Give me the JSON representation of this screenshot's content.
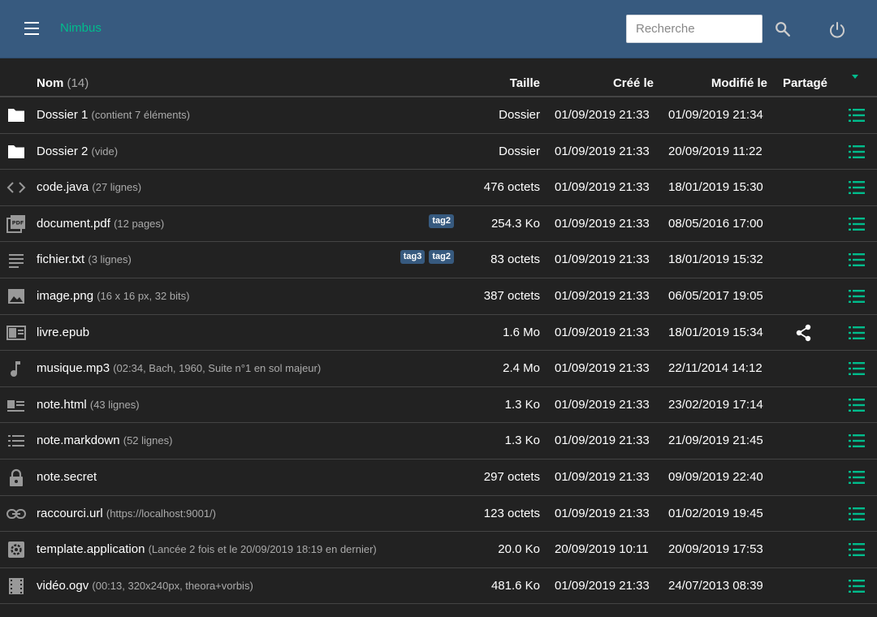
{
  "header": {
    "brand": "Nimbus",
    "search_placeholder": "Recherche",
    "accent_color": "#00bc8c",
    "bar_color": "#375a7f"
  },
  "table": {
    "columns": {
      "name": "Nom",
      "count": "(14)",
      "size": "Taille",
      "created": "Créé le",
      "modified": "Modifié le",
      "shared": "Partagé"
    },
    "rows": [
      {
        "icon": "folder-icon",
        "name": "Dossier 1",
        "detail": "(contient 7 éléments)",
        "tags": [],
        "size": "Dossier",
        "created": "01/09/2019 21:33",
        "modified": "01/09/2019 21:34",
        "shared": false
      },
      {
        "icon": "folder-icon",
        "name": "Dossier 2",
        "detail": "(vide)",
        "tags": [],
        "size": "Dossier",
        "created": "01/09/2019 21:33",
        "modified": "20/09/2019 11:22",
        "shared": false
      },
      {
        "icon": "code-icon",
        "name": "code.java",
        "detail": "(27 lignes)",
        "tags": [],
        "size": "476 octets",
        "created": "01/09/2019 21:33",
        "modified": "18/01/2019 15:30",
        "shared": false
      },
      {
        "icon": "pdf-icon",
        "name": "document.pdf",
        "detail": "(12 pages)",
        "tags": [
          "tag2"
        ],
        "size": "254.3 Ko",
        "created": "01/09/2019 21:33",
        "modified": "08/05/2016 17:00",
        "shared": false
      },
      {
        "icon": "text-icon",
        "name": "fichier.txt",
        "detail": "(3 lignes)",
        "tags": [
          "tag3",
          "tag2"
        ],
        "size": "83 octets",
        "created": "01/09/2019 21:33",
        "modified": "18/01/2019 15:32",
        "shared": false
      },
      {
        "icon": "image-icon",
        "name": "image.png",
        "detail": "(16 x 16 px, 32 bits)",
        "tags": [],
        "size": "387 octets",
        "created": "01/09/2019 21:33",
        "modified": "06/05/2017 19:05",
        "shared": false
      },
      {
        "icon": "book-icon",
        "name": "livre.epub",
        "detail": "",
        "tags": [],
        "size": "1.6 Mo",
        "created": "01/09/2019 21:33",
        "modified": "18/01/2019 15:34",
        "shared": true
      },
      {
        "icon": "music-icon",
        "name": "musique.mp3",
        "detail": "(02:34, Bach, 1960, Suite n°1 en sol majeur)",
        "tags": [],
        "size": "2.4 Mo",
        "created": "01/09/2019 21:33",
        "modified": "22/11/2014 14:12",
        "shared": false
      },
      {
        "icon": "article-icon",
        "name": "note.html",
        "detail": "(43 lignes)",
        "tags": [],
        "size": "1.3 Ko",
        "created": "01/09/2019 21:33",
        "modified": "23/02/2019 17:14",
        "shared": false
      },
      {
        "icon": "list-icon",
        "name": "note.markdown",
        "detail": "(52 lignes)",
        "tags": [],
        "size": "1.3 Ko",
        "created": "01/09/2019 21:33",
        "modified": "21/09/2019 21:45",
        "shared": false
      },
      {
        "icon": "lock-icon",
        "name": "note.secret",
        "detail": "",
        "tags": [],
        "size": "297 octets",
        "created": "01/09/2019 21:33",
        "modified": "09/09/2019 22:40",
        "shared": false
      },
      {
        "icon": "link-icon",
        "name": "raccourci.url",
        "detail": "(https://localhost:9001/)",
        "tags": [],
        "size": "123 octets",
        "created": "01/09/2019 21:33",
        "modified": "01/02/2019 19:45",
        "shared": false
      },
      {
        "icon": "gear-icon",
        "name": "template.application",
        "detail": "(Lancée 2 fois et le 20/09/2019 18:19 en dernier)",
        "tags": [],
        "size": "20.0 Ko",
        "created": "20/09/2019 10:11",
        "modified": "20/09/2019 17:53",
        "shared": false
      },
      {
        "icon": "video-icon",
        "name": "vidéo.ogv",
        "detail": "(00:13, 320x240px, theora+vorbis)",
        "tags": [],
        "size": "481.6 Ko",
        "created": "01/09/2019 21:33",
        "modified": "24/07/2013 08:39",
        "shared": false
      }
    ]
  }
}
